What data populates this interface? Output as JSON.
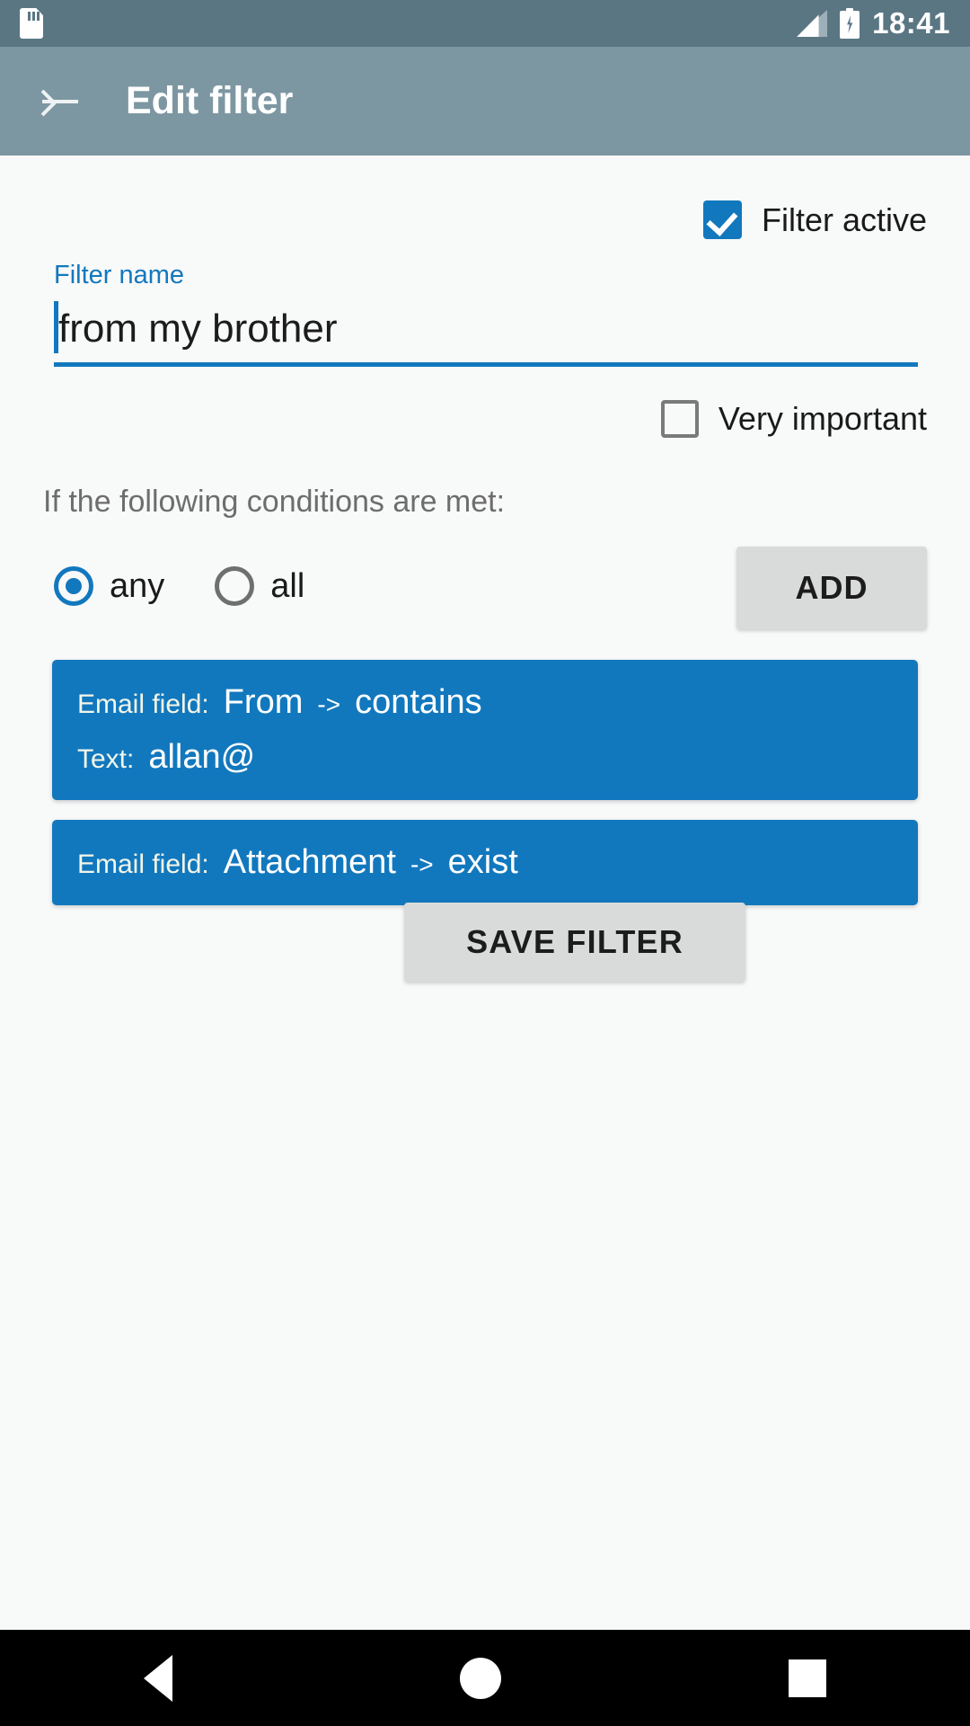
{
  "status_bar": {
    "sd_card_icon": "sd-card-icon",
    "signal_icon": "signal-icon",
    "battery_icon": "battery-charging-icon",
    "time": "18:41"
  },
  "app_bar": {
    "back_icon": "back-arrow-icon",
    "title": "Edit filter"
  },
  "form": {
    "filter_active": {
      "label": "Filter active",
      "checked": true
    },
    "filter_name": {
      "label": "Filter name",
      "value": "from my brother",
      "placeholder": "Filter name"
    },
    "very_important": {
      "label": "Very important",
      "checked": false
    },
    "conditions_label": "If the following conditions are met:",
    "match_mode": {
      "options": [
        "any",
        "all"
      ],
      "any_label": "any",
      "all_label": "all",
      "selected": "any"
    },
    "add_button": "ADD",
    "save_button": "SAVE FILTER"
  },
  "conditions": [
    {
      "field_key": "Email field:",
      "field_value": "From",
      "arrow": "->",
      "operator": "contains",
      "text_key": "Text:",
      "text_value": "allan@"
    },
    {
      "field_key": "Email field:",
      "field_value": "Attachment",
      "arrow": "->",
      "operator": "exist"
    }
  ],
  "nav_bar": {
    "back": "nav-back-icon",
    "home": "nav-home-icon",
    "recent": "nav-recent-icon"
  },
  "colors": {
    "status_bar": "#5a7683",
    "app_bar": "#7d97a2",
    "accent": "#1278be",
    "content_bg": "#f8f9f9",
    "button_grey": "#d9dbdb"
  }
}
